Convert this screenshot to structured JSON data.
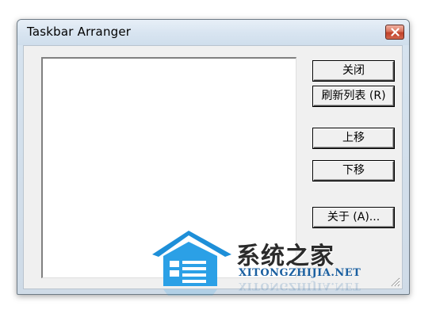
{
  "window": {
    "title": "Taskbar Arranger"
  },
  "buttons": {
    "close": "关闭",
    "refresh": "刷新列表 (R)",
    "move_up": "上移",
    "move_down": "下移",
    "about": "关于 (A)..."
  },
  "list": {
    "items": []
  },
  "watermark": {
    "brand_cn": "系统之家",
    "brand_en": "XITONGZHIJIA.NET"
  },
  "colors": {
    "titlebar": "#d9e5f1",
    "close_button": "#c7442c",
    "client_bg": "#f0f0f0",
    "watermark_blue": "#1e8fd8"
  }
}
